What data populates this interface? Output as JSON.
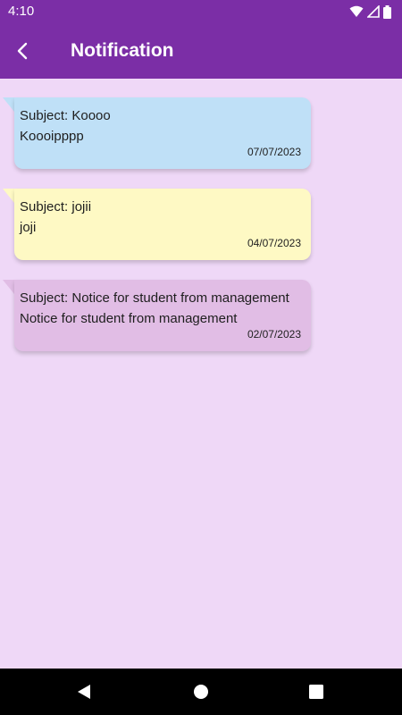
{
  "status_bar": {
    "time": "4:10",
    "icons": [
      "wifi-icon",
      "signal-icon",
      "battery-icon"
    ]
  },
  "app_bar": {
    "title": "Notification",
    "back_icon": "chevron-left-icon",
    "background": "#7b2ea6"
  },
  "notifications": [
    {
      "subject": "Subject: Koooo",
      "body": "Koooipppp",
      "date": "07/07/2023",
      "color": "#bfe0f7"
    },
    {
      "subject": "Subject: jojii",
      "body": "joji",
      "date": "04/07/2023",
      "color": "#fef9c4"
    },
    {
      "subject": "Subject: Notice for student from management",
      "body": "Notice for student from management",
      "date": "02/07/2023",
      "color": "#e1bde5"
    }
  ],
  "nav_bar": {
    "buttons": [
      "back-triangle-icon",
      "home-circle-icon",
      "recents-square-icon"
    ]
  },
  "colors": {
    "page_background": "#efd8f7"
  }
}
